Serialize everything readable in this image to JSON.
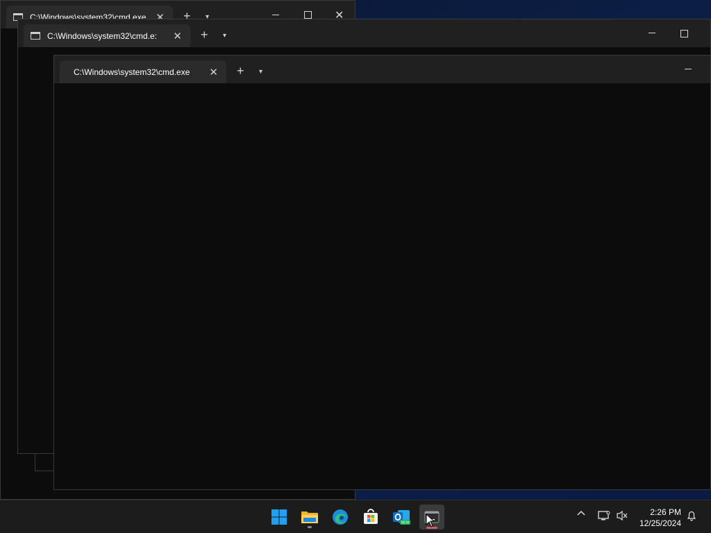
{
  "windows": [
    {
      "id": "win-back",
      "tab_title": "C:\\Windows\\system32\\cmd.exe"
    },
    {
      "id": "win-middle",
      "tab_title": "C:\\Windows\\system32\\cmd.e:"
    },
    {
      "id": "win-front",
      "tab_title": "C:\\Windows\\system32\\cmd.exe"
    }
  ],
  "taskbar": {
    "apps": [
      {
        "name": "start-button",
        "icon": "windows-logo-icon"
      },
      {
        "name": "file-explorer",
        "icon": "folder-icon"
      },
      {
        "name": "edge",
        "icon": "edge-icon"
      },
      {
        "name": "store",
        "icon": "store-icon"
      },
      {
        "name": "outlook",
        "icon": "outlook-icon",
        "badge": "NEW"
      },
      {
        "name": "terminal",
        "icon": "terminal-icon"
      }
    ],
    "clock": {
      "time": "2:26 PM",
      "date": "12/25/2024"
    }
  },
  "colors": {
    "terminal_bg": "#0c0c0c",
    "titlebar_bg": "#202020",
    "tab_bg": "#2b2b2b",
    "taskbar_bg": "#1c1c1c"
  }
}
